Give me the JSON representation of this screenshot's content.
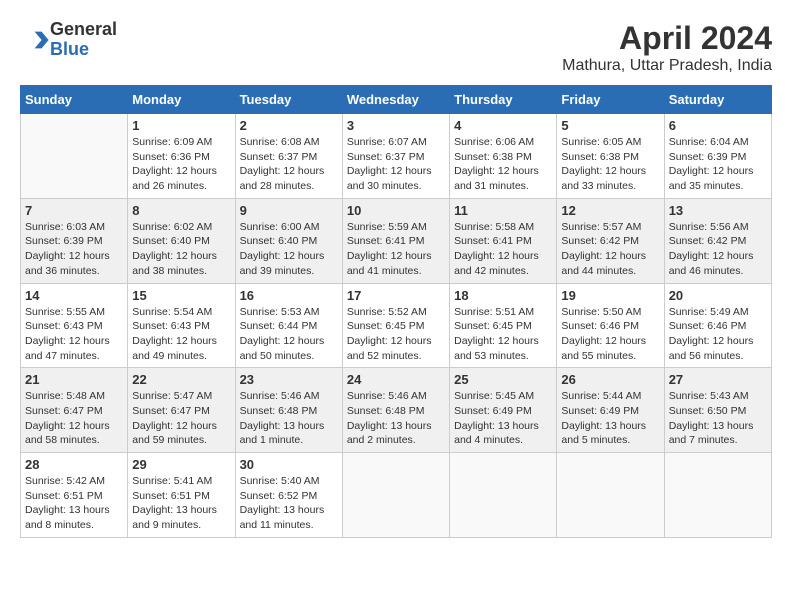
{
  "logo": {
    "general": "General",
    "blue": "Blue"
  },
  "title": {
    "month_year": "April 2024",
    "location": "Mathura, Uttar Pradesh, India"
  },
  "calendar": {
    "headers": [
      "Sunday",
      "Monday",
      "Tuesday",
      "Wednesday",
      "Thursday",
      "Friday",
      "Saturday"
    ],
    "rows": [
      {
        "shade": "white",
        "days": [
          {
            "num": "",
            "info": ""
          },
          {
            "num": "1",
            "info": "Sunrise: 6:09 AM\nSunset: 6:36 PM\nDaylight: 12 hours\nand 26 minutes."
          },
          {
            "num": "2",
            "info": "Sunrise: 6:08 AM\nSunset: 6:37 PM\nDaylight: 12 hours\nand 28 minutes."
          },
          {
            "num": "3",
            "info": "Sunrise: 6:07 AM\nSunset: 6:37 PM\nDaylight: 12 hours\nand 30 minutes."
          },
          {
            "num": "4",
            "info": "Sunrise: 6:06 AM\nSunset: 6:38 PM\nDaylight: 12 hours\nand 31 minutes."
          },
          {
            "num": "5",
            "info": "Sunrise: 6:05 AM\nSunset: 6:38 PM\nDaylight: 12 hours\nand 33 minutes."
          },
          {
            "num": "6",
            "info": "Sunrise: 6:04 AM\nSunset: 6:39 PM\nDaylight: 12 hours\nand 35 minutes."
          }
        ]
      },
      {
        "shade": "shade",
        "days": [
          {
            "num": "7",
            "info": "Sunrise: 6:03 AM\nSunset: 6:39 PM\nDaylight: 12 hours\nand 36 minutes."
          },
          {
            "num": "8",
            "info": "Sunrise: 6:02 AM\nSunset: 6:40 PM\nDaylight: 12 hours\nand 38 minutes."
          },
          {
            "num": "9",
            "info": "Sunrise: 6:00 AM\nSunset: 6:40 PM\nDaylight: 12 hours\nand 39 minutes."
          },
          {
            "num": "10",
            "info": "Sunrise: 5:59 AM\nSunset: 6:41 PM\nDaylight: 12 hours\nand 41 minutes."
          },
          {
            "num": "11",
            "info": "Sunrise: 5:58 AM\nSunset: 6:41 PM\nDaylight: 12 hours\nand 42 minutes."
          },
          {
            "num": "12",
            "info": "Sunrise: 5:57 AM\nSunset: 6:42 PM\nDaylight: 12 hours\nand 44 minutes."
          },
          {
            "num": "13",
            "info": "Sunrise: 5:56 AM\nSunset: 6:42 PM\nDaylight: 12 hours\nand 46 minutes."
          }
        ]
      },
      {
        "shade": "white",
        "days": [
          {
            "num": "14",
            "info": "Sunrise: 5:55 AM\nSunset: 6:43 PM\nDaylight: 12 hours\nand 47 minutes."
          },
          {
            "num": "15",
            "info": "Sunrise: 5:54 AM\nSunset: 6:43 PM\nDaylight: 12 hours\nand 49 minutes."
          },
          {
            "num": "16",
            "info": "Sunrise: 5:53 AM\nSunset: 6:44 PM\nDaylight: 12 hours\nand 50 minutes."
          },
          {
            "num": "17",
            "info": "Sunrise: 5:52 AM\nSunset: 6:45 PM\nDaylight: 12 hours\nand 52 minutes."
          },
          {
            "num": "18",
            "info": "Sunrise: 5:51 AM\nSunset: 6:45 PM\nDaylight: 12 hours\nand 53 minutes."
          },
          {
            "num": "19",
            "info": "Sunrise: 5:50 AM\nSunset: 6:46 PM\nDaylight: 12 hours\nand 55 minutes."
          },
          {
            "num": "20",
            "info": "Sunrise: 5:49 AM\nSunset: 6:46 PM\nDaylight: 12 hours\nand 56 minutes."
          }
        ]
      },
      {
        "shade": "shade",
        "days": [
          {
            "num": "21",
            "info": "Sunrise: 5:48 AM\nSunset: 6:47 PM\nDaylight: 12 hours\nand 58 minutes."
          },
          {
            "num": "22",
            "info": "Sunrise: 5:47 AM\nSunset: 6:47 PM\nDaylight: 12 hours\nand 59 minutes."
          },
          {
            "num": "23",
            "info": "Sunrise: 5:46 AM\nSunset: 6:48 PM\nDaylight: 13 hours\nand 1 minute."
          },
          {
            "num": "24",
            "info": "Sunrise: 5:46 AM\nSunset: 6:48 PM\nDaylight: 13 hours\nand 2 minutes."
          },
          {
            "num": "25",
            "info": "Sunrise: 5:45 AM\nSunset: 6:49 PM\nDaylight: 13 hours\nand 4 minutes."
          },
          {
            "num": "26",
            "info": "Sunrise: 5:44 AM\nSunset: 6:49 PM\nDaylight: 13 hours\nand 5 minutes."
          },
          {
            "num": "27",
            "info": "Sunrise: 5:43 AM\nSunset: 6:50 PM\nDaylight: 13 hours\nand 7 minutes."
          }
        ]
      },
      {
        "shade": "white",
        "days": [
          {
            "num": "28",
            "info": "Sunrise: 5:42 AM\nSunset: 6:51 PM\nDaylight: 13 hours\nand 8 minutes."
          },
          {
            "num": "29",
            "info": "Sunrise: 5:41 AM\nSunset: 6:51 PM\nDaylight: 13 hours\nand 9 minutes."
          },
          {
            "num": "30",
            "info": "Sunrise: 5:40 AM\nSunset: 6:52 PM\nDaylight: 13 hours\nand 11 minutes."
          },
          {
            "num": "",
            "info": ""
          },
          {
            "num": "",
            "info": ""
          },
          {
            "num": "",
            "info": ""
          },
          {
            "num": "",
            "info": ""
          }
        ]
      }
    ]
  }
}
